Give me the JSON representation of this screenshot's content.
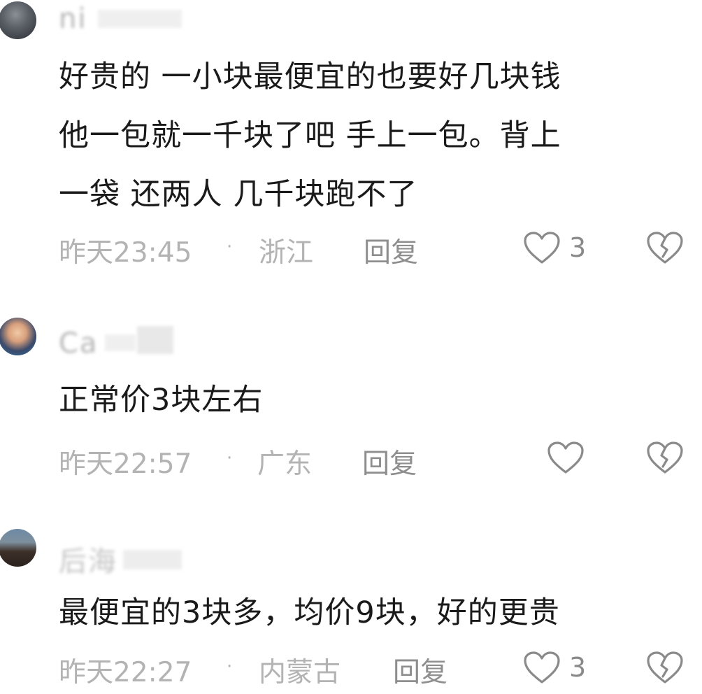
{
  "comments": [
    {
      "username": "ni",
      "body_lines": [
        "好贵的 一小块最便宜的也要好几块钱",
        "他一包就一千块了吧 手上一包。背上",
        "一袋 还两人 几千块跑不了"
      ],
      "time": "昨天23:45",
      "separator": "·",
      "location": "浙江",
      "reply_label": "回复",
      "like_count": "3",
      "like_icon": "heart-outline-icon",
      "dislike_icon": "broken-heart-icon"
    },
    {
      "username": "Ca",
      "body_lines": [
        "正常价3块左右"
      ],
      "time": "昨天22:57",
      "separator": "·",
      "location": "广东",
      "reply_label": "回复",
      "like_count": "",
      "like_icon": "heart-outline-icon",
      "dislike_icon": "broken-heart-icon"
    },
    {
      "username": "后海",
      "body_lines": [
        "最便宜的3块多，均价9块，好的更贵"
      ],
      "time": "昨天22:27",
      "separator": "·",
      "location": "内蒙古",
      "reply_label": "回复",
      "like_count": "3",
      "like_icon": "heart-outline-icon",
      "dislike_icon": "broken-heart-icon"
    }
  ],
  "colors": {
    "text": "#1a1a1a",
    "meta": "#b3b3b3",
    "reply": "#8e8e8e",
    "icon_stroke": "#8a8a8a"
  }
}
